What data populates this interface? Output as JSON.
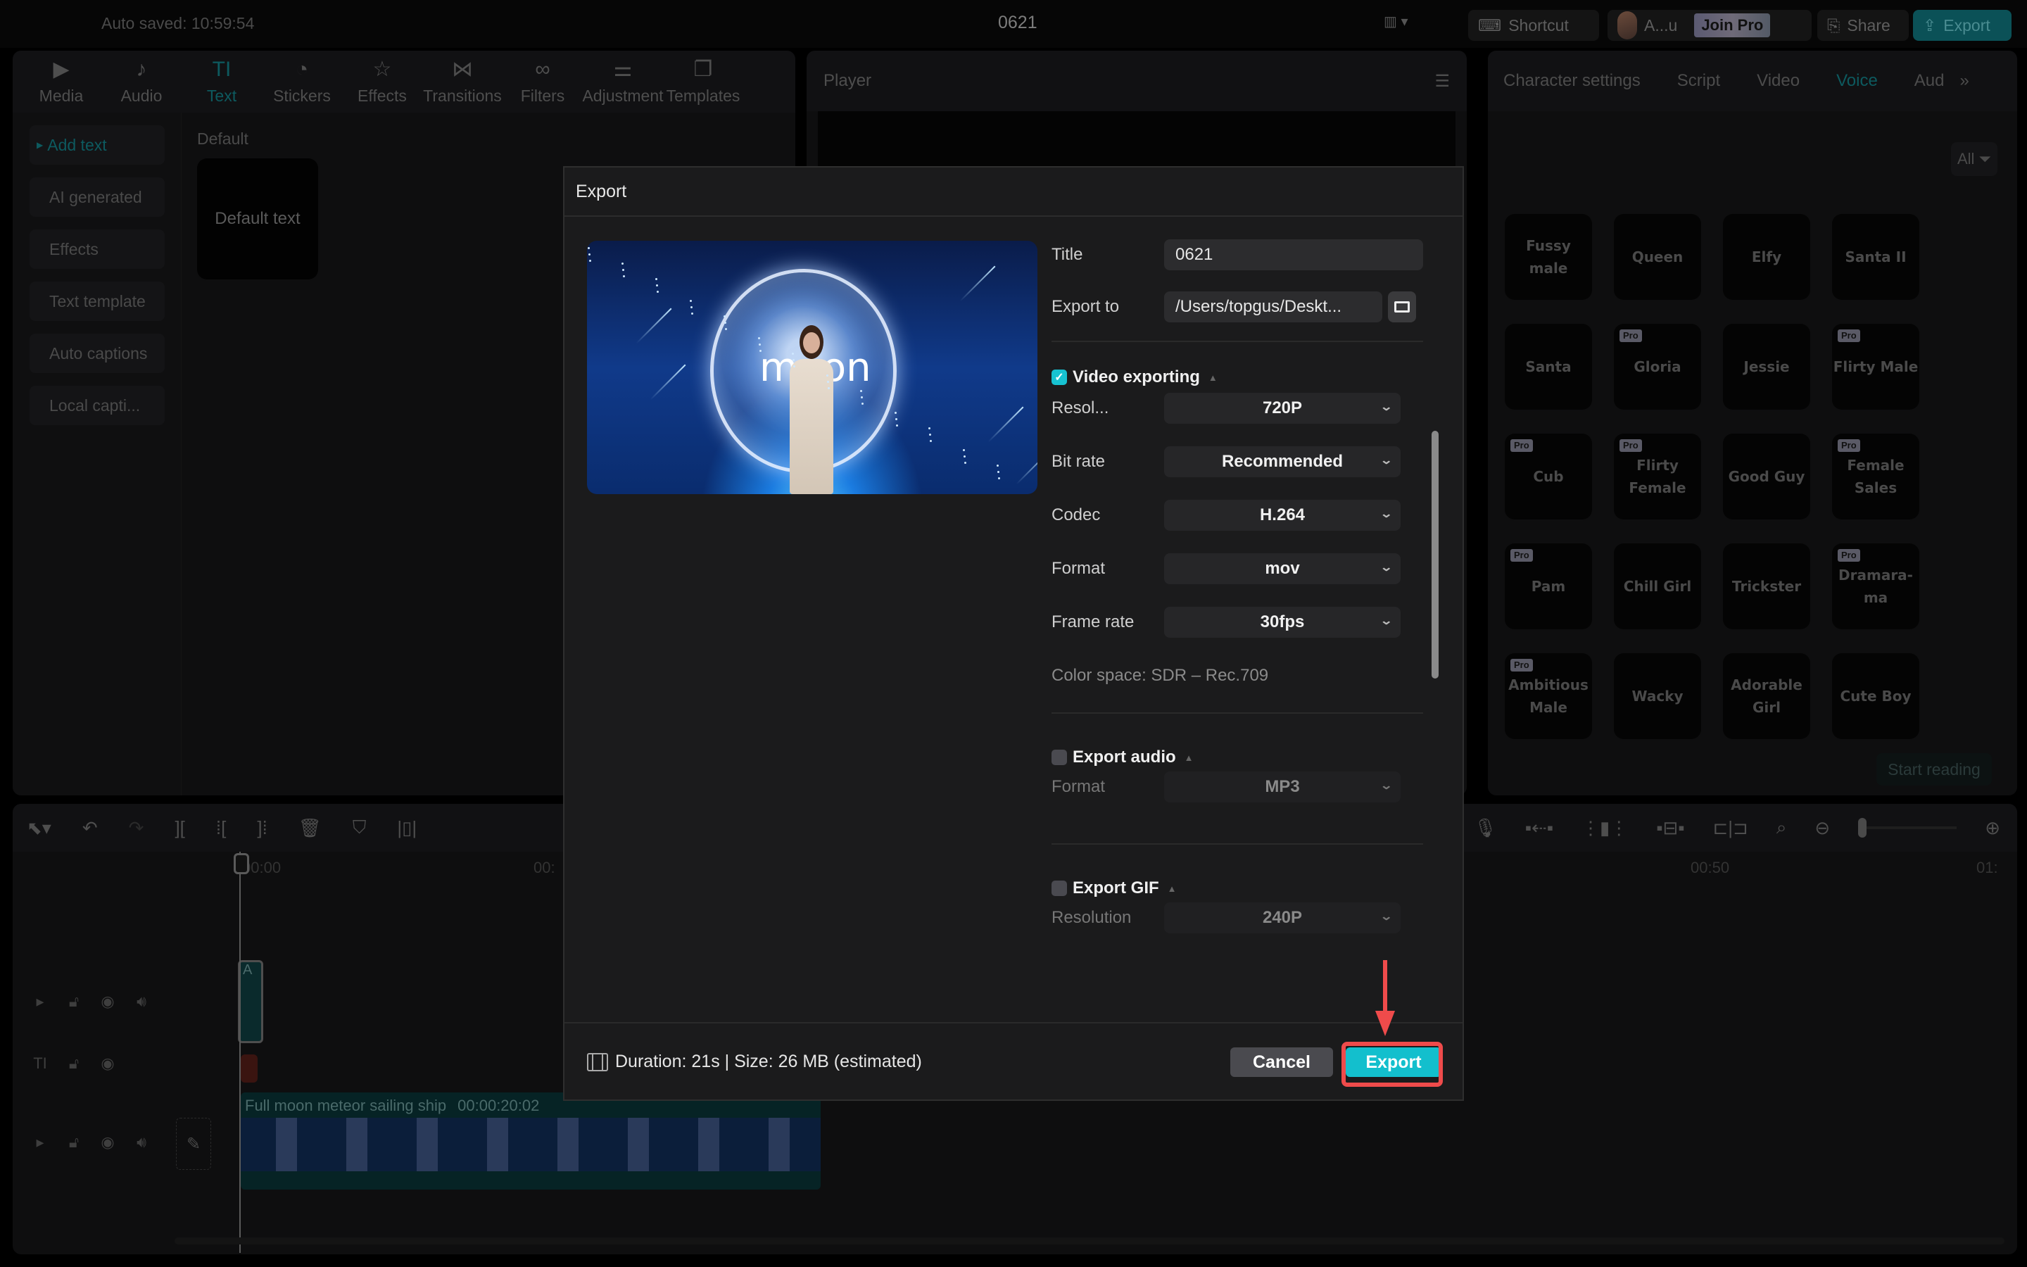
{
  "topbar": {
    "autosaved": "Auto saved: 10:59:54",
    "project_title": "0621",
    "shortcut_label": "Shortcut",
    "user_name": "A...u",
    "join_pro_label": "Join Pro",
    "share_label": "Share",
    "export_label": "Export"
  },
  "media_tabs": [
    {
      "label": "Media",
      "icon": "media-icon",
      "glyph": "▶"
    },
    {
      "label": "Audio",
      "icon": "audio-icon",
      "glyph": "♪"
    },
    {
      "label": "Text",
      "icon": "text-icon",
      "glyph": "TI",
      "active": true
    },
    {
      "label": "Stickers",
      "icon": "stickers-icon",
      "glyph": "◔"
    },
    {
      "label": "Effects",
      "icon": "effects-icon",
      "glyph": "☆"
    },
    {
      "label": "Transitions",
      "icon": "transitions-icon",
      "glyph": "⋈"
    },
    {
      "label": "Filters",
      "icon": "filters-icon",
      "glyph": "∞"
    },
    {
      "label": "Adjustment",
      "icon": "adjustment-icon",
      "glyph": "⚌"
    },
    {
      "label": "Templates",
      "icon": "templates-icon",
      "glyph": "❐"
    }
  ],
  "text_sidebar": [
    "Add text",
    "AI generated",
    "Effects",
    "Text template",
    "Auto captions",
    "Local capti..."
  ],
  "text_content": {
    "section": "Default",
    "card": "Default text"
  },
  "player": {
    "title": "Player"
  },
  "right_tabs": [
    "Character settings",
    "Script",
    "Video",
    "Voice",
    "Aud"
  ],
  "right_active_tab": "Voice",
  "filter": {
    "label": "All"
  },
  "voices": [
    {
      "name": "Fussy male",
      "pro": false
    },
    {
      "name": "Queen",
      "pro": false
    },
    {
      "name": "Elfy",
      "pro": false
    },
    {
      "name": "Santa II",
      "pro": false
    },
    {
      "name": "Santa",
      "pro": false
    },
    {
      "name": "Gloria",
      "pro": true
    },
    {
      "name": "Jessie",
      "pro": false
    },
    {
      "name": "Flirty Male",
      "pro": true
    },
    {
      "name": "Cub",
      "pro": true
    },
    {
      "name": "Flirty Female",
      "pro": true
    },
    {
      "name": "Good Guy",
      "pro": false
    },
    {
      "name": "Female Sales",
      "pro": true
    },
    {
      "name": "Pam",
      "pro": true
    },
    {
      "name": "Chill Girl",
      "pro": false
    },
    {
      "name": "Trickster",
      "pro": false
    },
    {
      "name": "Dramara-ma",
      "pro": true
    },
    {
      "name": "Ambitious Male",
      "pro": true
    },
    {
      "name": "Wacky",
      "pro": false
    },
    {
      "name": "Adorable Girl",
      "pro": false
    },
    {
      "name": "Cute Boy",
      "pro": false
    }
  ],
  "pro_badge": "Pro",
  "start_reading": "Start reading",
  "timeline": {
    "ruler": [
      "00:00",
      "00:",
      "00:50",
      "01:"
    ],
    "clip_title": "Full moon meteor sailing ship",
    "clip_duration": "00:00:20:02",
    "small_clip_label": "A"
  },
  "dialog": {
    "title": "Export",
    "preview_text": "moon",
    "title_label": "Title",
    "title_value": "0621",
    "export_to_label": "Export to",
    "export_to_value": "/Users/topgus/Deskt...",
    "video": {
      "heading": "Video exporting",
      "checked": true,
      "resolution_label": "Resol...",
      "resolution": "720P",
      "bitrate_label": "Bit rate",
      "bitrate": "Recommended",
      "codec_label": "Codec",
      "codec": "H.264",
      "format_label": "Format",
      "format": "mov",
      "framerate_label": "Frame rate",
      "framerate": "30fps",
      "color_space": "Color space: SDR – Rec.709"
    },
    "audio": {
      "heading": "Export audio",
      "checked": false,
      "format_label": "Format",
      "format": "MP3"
    },
    "gif": {
      "heading": "Export GIF",
      "checked": false,
      "resolution_label": "Resolution",
      "resolution": "240P"
    },
    "footer_info": "Duration: 21s | Size: 26 MB (estimated)",
    "cancel_label": "Cancel",
    "export_label": "Export"
  },
  "colors": {
    "accent": "#13bfcd",
    "annotation": "#ef4b4b",
    "dim_teal": "#0d5a5f"
  }
}
